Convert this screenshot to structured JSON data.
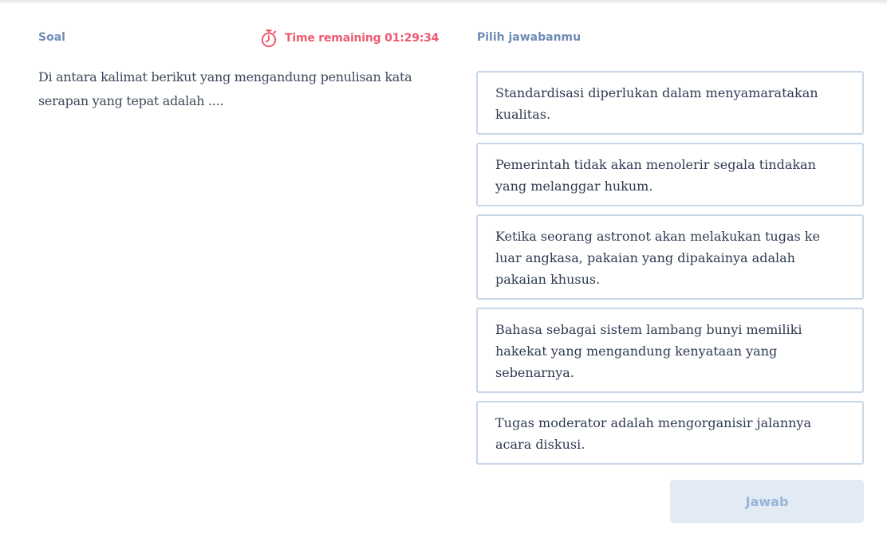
{
  "question_panel": {
    "label": "Soal",
    "timer": {
      "icon": "stopwatch-icon",
      "text": "Time remaining 01:29:34",
      "color": "#ee5a6f"
    },
    "question_text": "Di antara kalimat berikut yang mengandung penulisan kata serapan yang tepat adalah ...."
  },
  "answer_panel": {
    "label": "Pilih jawabanmu",
    "options": [
      "Standardisasi diperlukan dalam menyamaratakan kualitas.",
      "Pemerintah tidak akan menolerir segala tindakan yang melanggar hukum.",
      "Ketika seorang astronot akan melakukan tugas ke luar angkasa, pakaian yang dipakainya adalah pakaian khusus.",
      "Bahasa sebagai sistem lambang bunyi memiliki hakekat yang mengandung kenyataan yang sebenarnya.",
      "Tugas moderator adalah mengorganisir jalannya acara diskusi."
    ],
    "submit_label": "Jawab"
  },
  "colors": {
    "label": "#6f8cb4",
    "option_border": "#c9d7e6",
    "submit_bg": "#e2eaf4",
    "submit_text": "#97b3d8"
  }
}
